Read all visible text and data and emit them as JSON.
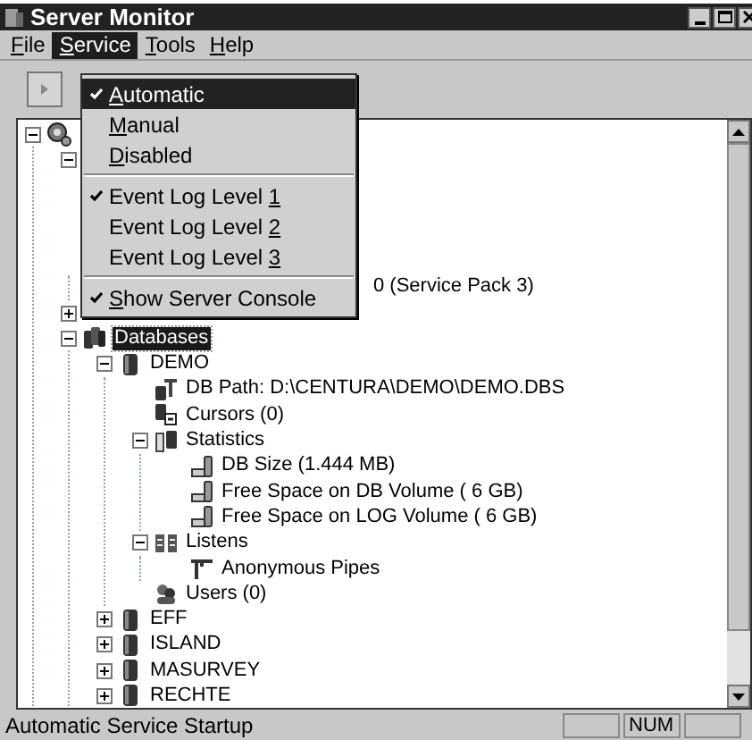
{
  "window": {
    "title": "Server Monitor"
  },
  "menu_bar": [
    {
      "access_key": "F",
      "text_after": "ile",
      "selected": false
    },
    {
      "access_key": "S",
      "text_after": "ervice",
      "selected": true
    },
    {
      "access_key": "T",
      "text_after": "ools",
      "selected": false
    },
    {
      "access_key": "H",
      "text_after": "elp",
      "selected": false
    }
  ],
  "service_menu": [
    {
      "kind": "item",
      "access_key": "A",
      "text_after": "utomatic",
      "checked": true,
      "selected": true
    },
    {
      "kind": "item",
      "access_key": "M",
      "text_after": "anual",
      "checked": false,
      "selected": false
    },
    {
      "kind": "item",
      "access_key": "D",
      "text_after": "isabled",
      "checked": false,
      "selected": false
    },
    {
      "kind": "separator"
    },
    {
      "kind": "item",
      "text_before": "Event Log Level ",
      "access_key": "1",
      "checked": true,
      "selected": false
    },
    {
      "kind": "item",
      "text_before": "Event Log Level ",
      "access_key": "2",
      "checked": false,
      "selected": false
    },
    {
      "kind": "item",
      "text_before": "Event Log Level ",
      "access_key": "3",
      "checked": false,
      "selected": false
    },
    {
      "kind": "separator"
    },
    {
      "kind": "item",
      "access_key": "S",
      "text_after": "how Server Console",
      "checked": true,
      "selected": false
    }
  ],
  "tree": [
    {
      "kind": "server",
      "expanded": true,
      "children": [
        {
          "kind": "hidden",
          "expanded": true,
          "children": [
            {
              "kind": "obscured",
              "label": "0 (Service Pack 3)"
            }
          ]
        },
        {
          "kind": "hidden",
          "expanded": false
        },
        {
          "kind": "database-group",
          "label": "Databases",
          "expanded": true,
          "selected": true,
          "children": [
            {
              "kind": "database",
              "label": "DEMO",
              "expanded": true,
              "selected": false,
              "children": [
                {
                  "kind": "db-path",
                  "label": "DB Path: D:\\CENTURA\\DEMO\\DEMO.DBS",
                  "selected": false
                },
                {
                  "kind": "cursors",
                  "label": "Cursors (0)",
                  "selected": false
                },
                {
                  "kind": "statistics",
                  "label": "Statistics",
                  "expanded": true,
                  "selected": false,
                  "children": [
                    {
                      "kind": "disk",
                      "label": "DB Size (1.444 MB)",
                      "selected": false
                    },
                    {
                      "kind": "disk",
                      "label": "Free Space on DB Volume (  6 GB)",
                      "selected": false
                    },
                    {
                      "kind": "disk",
                      "label": "Free Space on LOG Volume (  6 GB)",
                      "selected": false
                    }
                  ]
                },
                {
                  "kind": "listens",
                  "label": "Listens",
                  "expanded": true,
                  "selected": false,
                  "children": [
                    {
                      "kind": "pipe",
                      "label": "Anonymous Pipes",
                      "selected": false
                    }
                  ]
                },
                {
                  "kind": "users",
                  "label": "Users (0)",
                  "selected": false
                }
              ]
            },
            {
              "kind": "database",
              "label": "EFF",
              "expanded": false,
              "selected": false
            },
            {
              "kind": "database",
              "label": "ISLAND",
              "expanded": false,
              "selected": false
            },
            {
              "kind": "database",
              "label": "MASURVEY",
              "expanded": false,
              "selected": false
            },
            {
              "kind": "database",
              "label": "RECHTE",
              "expanded": false,
              "selected": false
            }
          ]
        }
      ]
    }
  ],
  "status_bar": {
    "message": "Automatic Service Startup",
    "panels": [
      {
        "kind": "empty"
      },
      {
        "kind": "text",
        "text": "NUM"
      },
      {
        "kind": "empty"
      }
    ]
  }
}
